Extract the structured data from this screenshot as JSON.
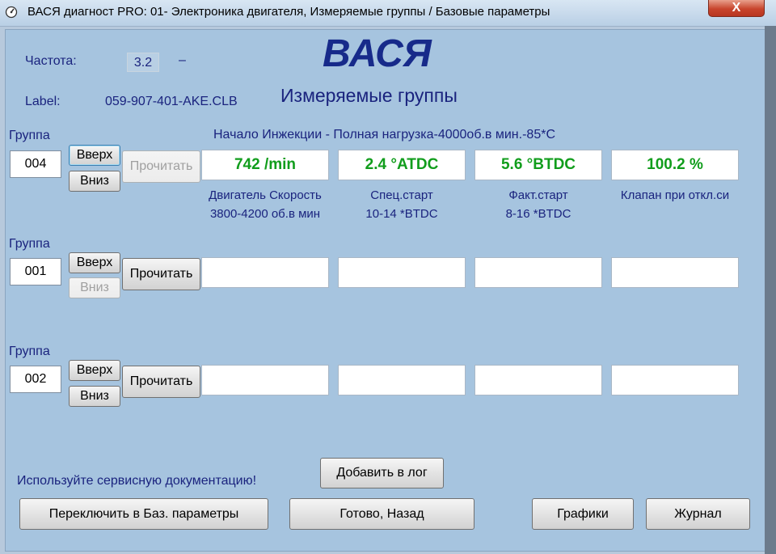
{
  "window": {
    "title": "ВАСЯ диагност PRO: 01- Электроника двигателя,  Измеряемые группы / Базовые параметры",
    "close_label": "X"
  },
  "header": {
    "freq_label": "Частота:",
    "freq_value": "3.2",
    "freq_dash": "–",
    "label_label": "Label:",
    "label_value": "059-907-401-AKE.CLB",
    "logo": "ВАСЯ",
    "subtitle": "Измеряемые группы"
  },
  "groups": [
    {
      "label": "Группа",
      "number": "004",
      "up_label": "Вверх",
      "down_label": "Вниз",
      "read_label": "Прочитать",
      "heading": "Начало Инжекции - Полная нагрузка-4000об.в мин.-85*С",
      "values": [
        "742 /min",
        "2.4 °ATDC",
        "5.6 °BTDC",
        "100.2 %"
      ],
      "desc1": [
        "Двигатель Скорость",
        "Спец.старт",
        "Факт.старт",
        "Клапан при откл.си"
      ],
      "desc2": [
        "3800-4200 об.в мин",
        "10-14 *BTDC",
        "8-16 *BTDC",
        ""
      ]
    },
    {
      "label": "Группа",
      "number": "001",
      "up_label": "Вверх",
      "down_label": "Вниз",
      "read_label": "Прочитать",
      "values": [
        "",
        "",
        "",
        ""
      ]
    },
    {
      "label": "Группа",
      "number": "002",
      "up_label": "Вверх",
      "down_label": "Вниз",
      "read_label": "Прочитать",
      "values": [
        "",
        "",
        "",
        ""
      ]
    }
  ],
  "footer": {
    "hint": "Используйте сервисную документацию!",
    "add_log": "Добавить в лог",
    "switch_basic": "Переключить в Баз. параметры",
    "done_back": "Готово, Назад",
    "graphs": "Графики",
    "journal": "Журнал"
  }
}
